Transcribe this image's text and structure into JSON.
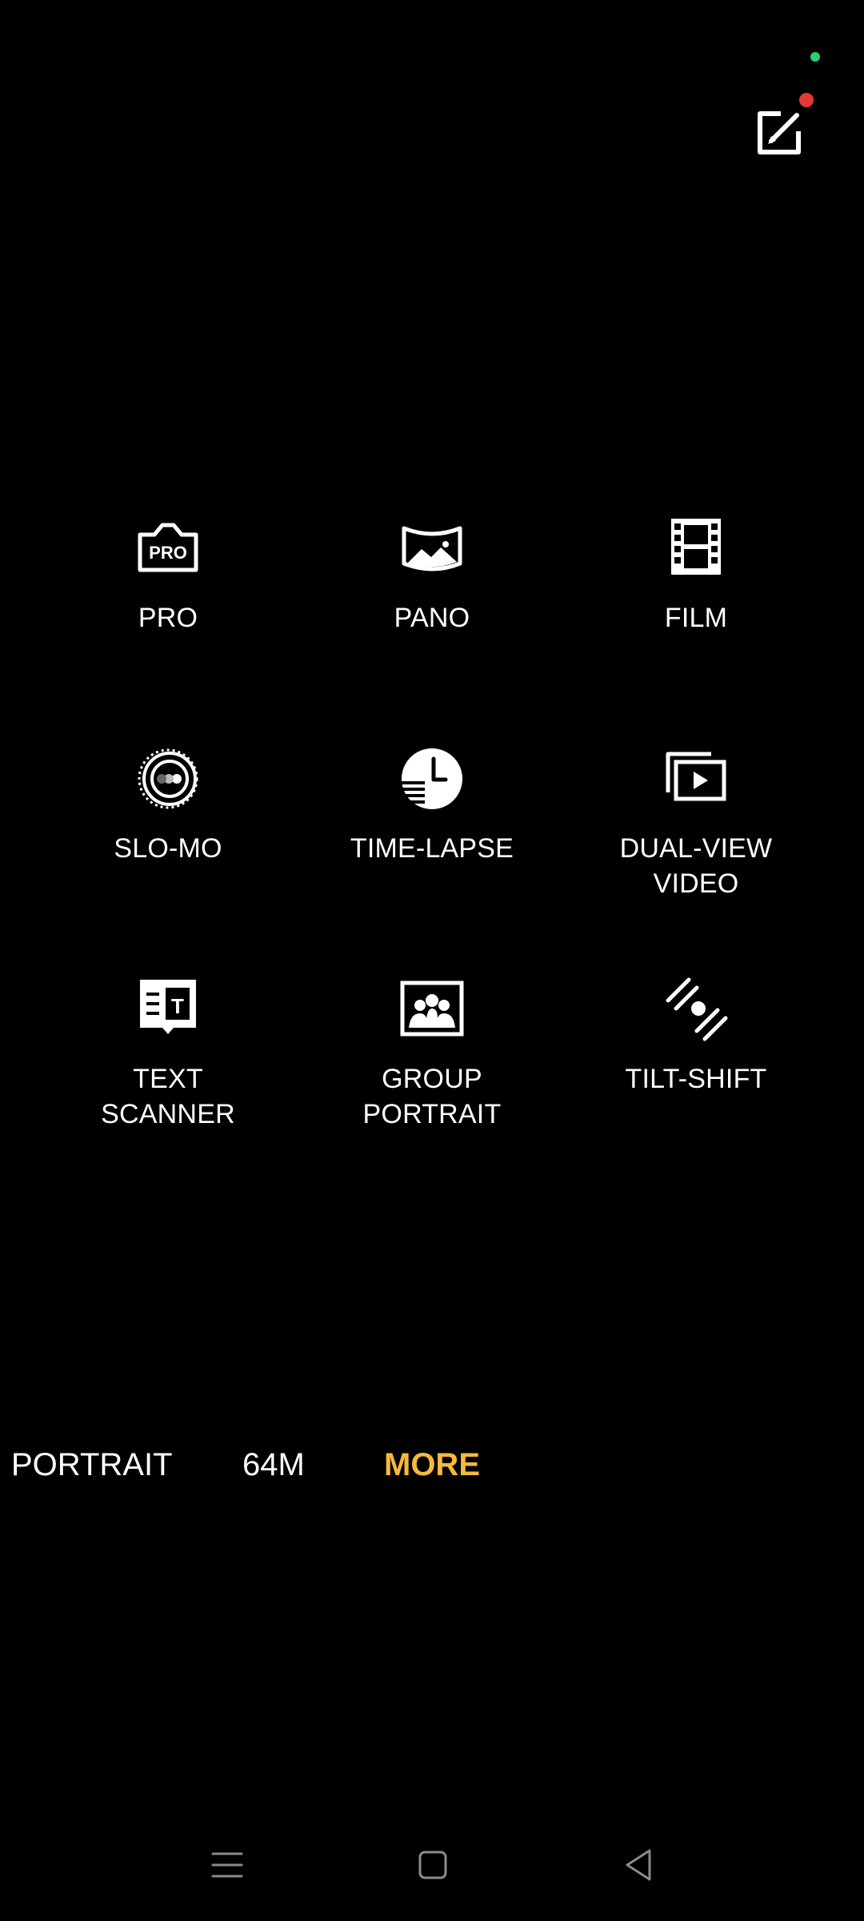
{
  "status": {
    "indicator_color": "#2ecc71"
  },
  "edit": {
    "icon": "edit-icon",
    "badge_color": "#e53935"
  },
  "modes": [
    {
      "label": "PRO",
      "icon": "pro-camera-icon"
    },
    {
      "label": "PANO",
      "icon": "panorama-icon"
    },
    {
      "label": "FILM",
      "icon": "film-icon"
    },
    {
      "label": "SLO-MO",
      "icon": "slow-motion-icon"
    },
    {
      "label": "TIME-LAPSE",
      "icon": "clock-icon"
    },
    {
      "label": "DUAL-VIEW\nVIDEO",
      "icon": "dual-view-video-icon"
    },
    {
      "label": "TEXT\nSCANNER",
      "icon": "text-scanner-icon"
    },
    {
      "label": "GROUP\nPORTRAIT",
      "icon": "group-portrait-icon"
    },
    {
      "label": "TILT-SHIFT",
      "icon": "tilt-shift-icon"
    }
  ],
  "bottom_modes": [
    {
      "label": "PORTRAIT",
      "active": false
    },
    {
      "label": "64M",
      "active": false
    },
    {
      "label": "MORE",
      "active": true
    }
  ],
  "colors": {
    "active": "#F5B93C",
    "text": "#FFFFFF",
    "background": "#000000"
  },
  "nav": {
    "menu": "menu-icon",
    "home": "home-icon",
    "back": "back-icon"
  }
}
